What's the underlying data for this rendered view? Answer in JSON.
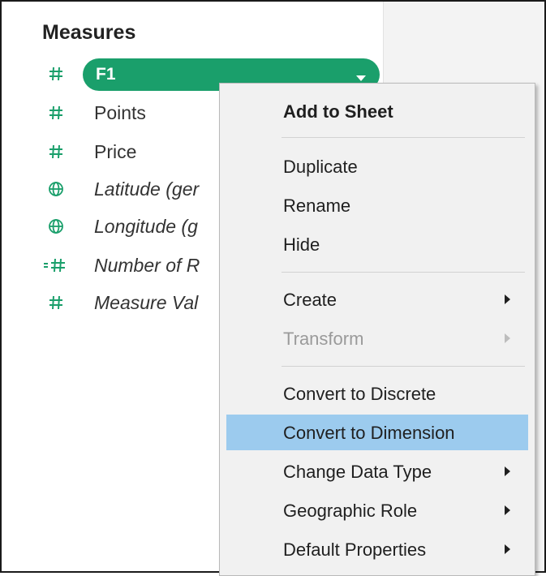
{
  "colors": {
    "measure_green": "#1a9f6b",
    "highlight_blue": "#9ccbee",
    "menu_bg": "#f1f1f1",
    "disabled_text": "#9a9a9a"
  },
  "data_pane": {
    "section_title": "Measures",
    "selected_field": {
      "label": "F1",
      "icon": "hash-icon",
      "dropdown_icon": "caret-down-icon"
    },
    "fields": [
      {
        "label": "Points",
        "icon": "hash-icon",
        "italic": false
      },
      {
        "label": "Price",
        "icon": "hash-icon",
        "italic": false
      },
      {
        "label": "Latitude (ger",
        "icon": "globe-icon",
        "italic": true
      },
      {
        "label": "Longitude (g",
        "icon": "globe-icon",
        "italic": true
      },
      {
        "label": "Number of R",
        "icon": "hash-equals-icon",
        "italic": true
      },
      {
        "label": "Measure Val",
        "icon": "hash-icon",
        "italic": true
      }
    ]
  },
  "context_menu": {
    "items": [
      {
        "label": "Add to Sheet",
        "bold": true,
        "submenu": false,
        "disabled": false,
        "highlighted": false
      },
      {
        "label": "Duplicate",
        "bold": false,
        "submenu": false,
        "disabled": false,
        "highlighted": false
      },
      {
        "label": "Rename",
        "bold": false,
        "submenu": false,
        "disabled": false,
        "highlighted": false
      },
      {
        "label": "Hide",
        "bold": false,
        "submenu": false,
        "disabled": false,
        "highlighted": false
      },
      {
        "label": "Create",
        "bold": false,
        "submenu": true,
        "disabled": false,
        "highlighted": false
      },
      {
        "label": "Transform",
        "bold": false,
        "submenu": true,
        "disabled": true,
        "highlighted": false
      },
      {
        "label": "Convert to Discrete",
        "bold": false,
        "submenu": false,
        "disabled": false,
        "highlighted": false
      },
      {
        "label": "Convert to Dimension",
        "bold": false,
        "submenu": false,
        "disabled": false,
        "highlighted": true
      },
      {
        "label": "Change Data Type",
        "bold": false,
        "submenu": true,
        "disabled": false,
        "highlighted": false
      },
      {
        "label": "Geographic Role",
        "bold": false,
        "submenu": true,
        "disabled": false,
        "highlighted": false
      },
      {
        "label": "Default Properties",
        "bold": false,
        "submenu": true,
        "disabled": false,
        "highlighted": false
      }
    ]
  }
}
